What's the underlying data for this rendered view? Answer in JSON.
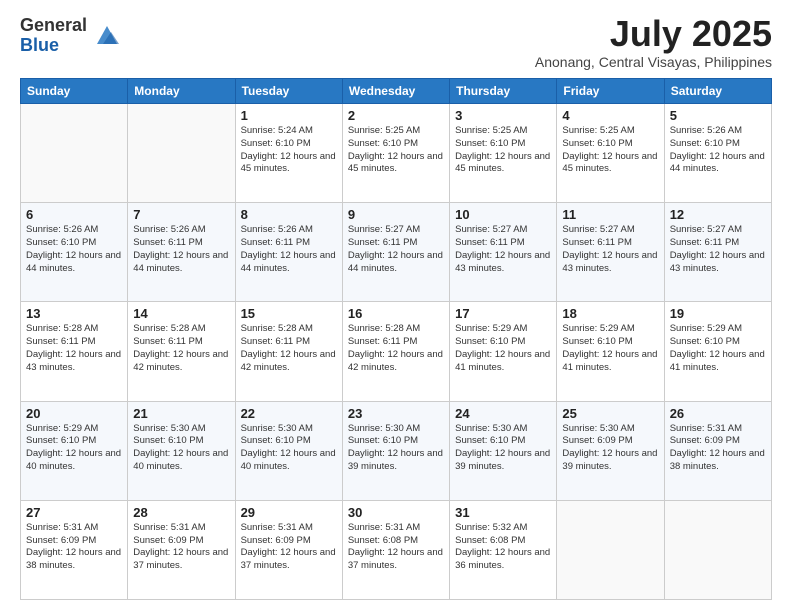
{
  "logo": {
    "general": "General",
    "blue": "Blue"
  },
  "header": {
    "month": "July 2025",
    "location": "Anonang, Central Visayas, Philippines"
  },
  "weekdays": [
    "Sunday",
    "Monday",
    "Tuesday",
    "Wednesday",
    "Thursday",
    "Friday",
    "Saturday"
  ],
  "weeks": [
    [
      {
        "day": "",
        "info": ""
      },
      {
        "day": "",
        "info": ""
      },
      {
        "day": "1",
        "info": "Sunrise: 5:24 AM\nSunset: 6:10 PM\nDaylight: 12 hours and 45 minutes."
      },
      {
        "day": "2",
        "info": "Sunrise: 5:25 AM\nSunset: 6:10 PM\nDaylight: 12 hours and 45 minutes."
      },
      {
        "day": "3",
        "info": "Sunrise: 5:25 AM\nSunset: 6:10 PM\nDaylight: 12 hours and 45 minutes."
      },
      {
        "day": "4",
        "info": "Sunrise: 5:25 AM\nSunset: 6:10 PM\nDaylight: 12 hours and 45 minutes."
      },
      {
        "day": "5",
        "info": "Sunrise: 5:26 AM\nSunset: 6:10 PM\nDaylight: 12 hours and 44 minutes."
      }
    ],
    [
      {
        "day": "6",
        "info": "Sunrise: 5:26 AM\nSunset: 6:10 PM\nDaylight: 12 hours and 44 minutes."
      },
      {
        "day": "7",
        "info": "Sunrise: 5:26 AM\nSunset: 6:11 PM\nDaylight: 12 hours and 44 minutes."
      },
      {
        "day": "8",
        "info": "Sunrise: 5:26 AM\nSunset: 6:11 PM\nDaylight: 12 hours and 44 minutes."
      },
      {
        "day": "9",
        "info": "Sunrise: 5:27 AM\nSunset: 6:11 PM\nDaylight: 12 hours and 44 minutes."
      },
      {
        "day": "10",
        "info": "Sunrise: 5:27 AM\nSunset: 6:11 PM\nDaylight: 12 hours and 43 minutes."
      },
      {
        "day": "11",
        "info": "Sunrise: 5:27 AM\nSunset: 6:11 PM\nDaylight: 12 hours and 43 minutes."
      },
      {
        "day": "12",
        "info": "Sunrise: 5:27 AM\nSunset: 6:11 PM\nDaylight: 12 hours and 43 minutes."
      }
    ],
    [
      {
        "day": "13",
        "info": "Sunrise: 5:28 AM\nSunset: 6:11 PM\nDaylight: 12 hours and 43 minutes."
      },
      {
        "day": "14",
        "info": "Sunrise: 5:28 AM\nSunset: 6:11 PM\nDaylight: 12 hours and 42 minutes."
      },
      {
        "day": "15",
        "info": "Sunrise: 5:28 AM\nSunset: 6:11 PM\nDaylight: 12 hours and 42 minutes."
      },
      {
        "day": "16",
        "info": "Sunrise: 5:28 AM\nSunset: 6:11 PM\nDaylight: 12 hours and 42 minutes."
      },
      {
        "day": "17",
        "info": "Sunrise: 5:29 AM\nSunset: 6:10 PM\nDaylight: 12 hours and 41 minutes."
      },
      {
        "day": "18",
        "info": "Sunrise: 5:29 AM\nSunset: 6:10 PM\nDaylight: 12 hours and 41 minutes."
      },
      {
        "day": "19",
        "info": "Sunrise: 5:29 AM\nSunset: 6:10 PM\nDaylight: 12 hours and 41 minutes."
      }
    ],
    [
      {
        "day": "20",
        "info": "Sunrise: 5:29 AM\nSunset: 6:10 PM\nDaylight: 12 hours and 40 minutes."
      },
      {
        "day": "21",
        "info": "Sunrise: 5:30 AM\nSunset: 6:10 PM\nDaylight: 12 hours and 40 minutes."
      },
      {
        "day": "22",
        "info": "Sunrise: 5:30 AM\nSunset: 6:10 PM\nDaylight: 12 hours and 40 minutes."
      },
      {
        "day": "23",
        "info": "Sunrise: 5:30 AM\nSunset: 6:10 PM\nDaylight: 12 hours and 39 minutes."
      },
      {
        "day": "24",
        "info": "Sunrise: 5:30 AM\nSunset: 6:10 PM\nDaylight: 12 hours and 39 minutes."
      },
      {
        "day": "25",
        "info": "Sunrise: 5:30 AM\nSunset: 6:09 PM\nDaylight: 12 hours and 39 minutes."
      },
      {
        "day": "26",
        "info": "Sunrise: 5:31 AM\nSunset: 6:09 PM\nDaylight: 12 hours and 38 minutes."
      }
    ],
    [
      {
        "day": "27",
        "info": "Sunrise: 5:31 AM\nSunset: 6:09 PM\nDaylight: 12 hours and 38 minutes."
      },
      {
        "day": "28",
        "info": "Sunrise: 5:31 AM\nSunset: 6:09 PM\nDaylight: 12 hours and 37 minutes."
      },
      {
        "day": "29",
        "info": "Sunrise: 5:31 AM\nSunset: 6:09 PM\nDaylight: 12 hours and 37 minutes."
      },
      {
        "day": "30",
        "info": "Sunrise: 5:31 AM\nSunset: 6:08 PM\nDaylight: 12 hours and 37 minutes."
      },
      {
        "day": "31",
        "info": "Sunrise: 5:32 AM\nSunset: 6:08 PM\nDaylight: 12 hours and 36 minutes."
      },
      {
        "day": "",
        "info": ""
      },
      {
        "day": "",
        "info": ""
      }
    ]
  ]
}
